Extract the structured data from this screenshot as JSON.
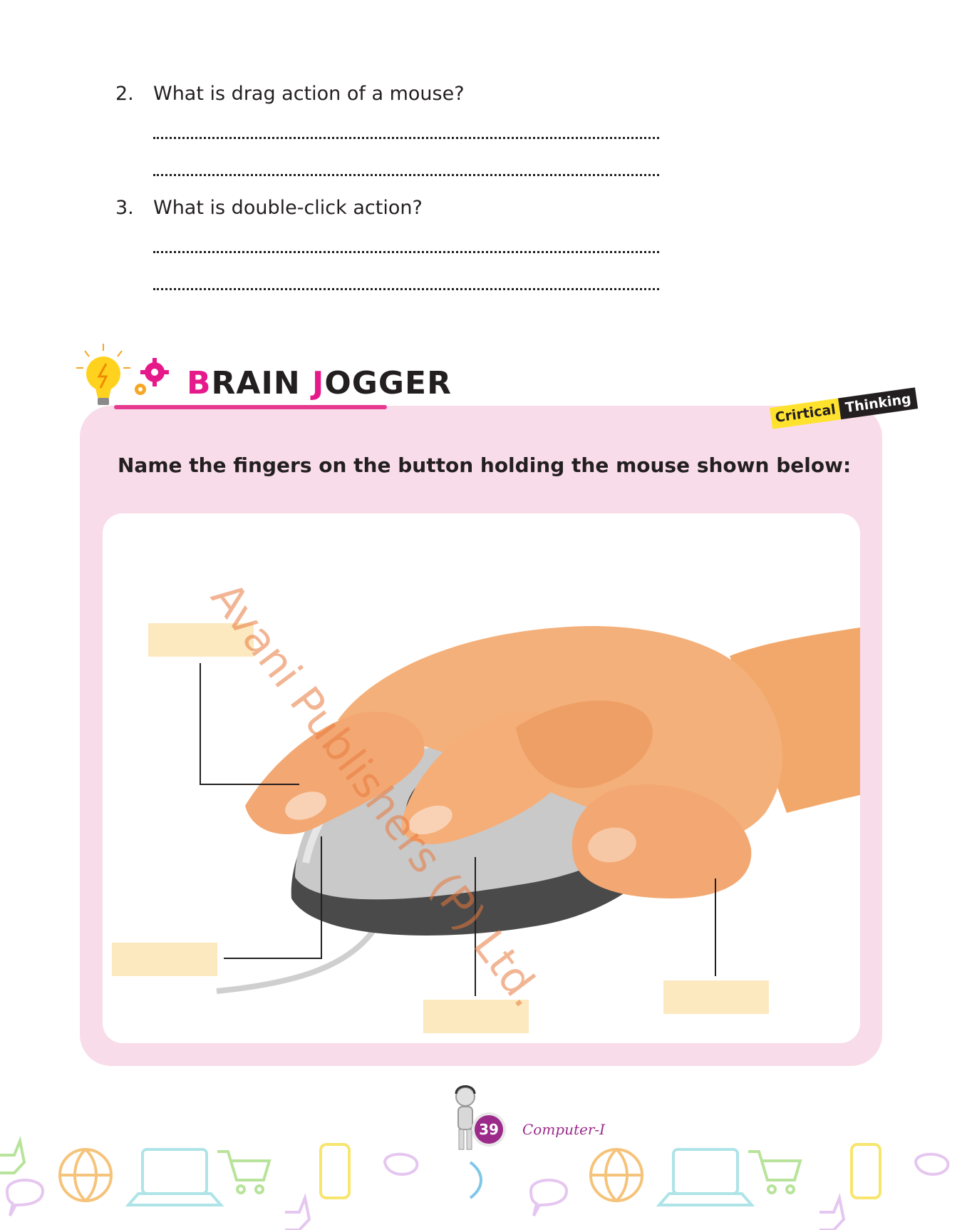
{
  "questions": [
    {
      "number": "2.",
      "text": "What is drag action of a mouse?"
    },
    {
      "number": "3.",
      "text": "What is double-click action?"
    }
  ],
  "section": {
    "title_first_letter": "B",
    "title_rest_1": "RAIN ",
    "title_second_letter": "J",
    "title_rest_2": "OGGER",
    "badge_part1": "Crirtical",
    "badge_part2": "Thinking",
    "instruction": "Name the fingers on the button holding the mouse shown below:"
  },
  "watermark": "Avani Publishers (P) Ltd.",
  "footer": {
    "page_number": "39",
    "book_name": "Computer-I"
  },
  "colors": {
    "accent_pink": "#e6198b",
    "panel_pink": "#f9dce9",
    "label_box": "#fde9bf",
    "page_badge": "#9b2a8a"
  },
  "icons": [
    "lightbulb-icon",
    "gear-icon",
    "mascot-icon",
    "globe-icon",
    "laptop-icon",
    "cart-icon",
    "phone-icon",
    "mouse-icon",
    "thumbs-up-icon",
    "chat-bubble-icon"
  ]
}
